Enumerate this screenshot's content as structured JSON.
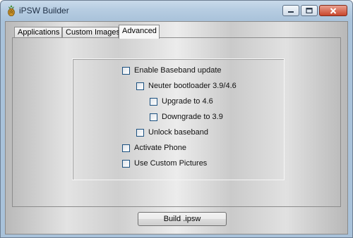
{
  "window": {
    "title": "iPSW Builder",
    "icon": "pineapple-icon",
    "controls": {
      "minimize_icon": "minimize-icon",
      "maximize_icon": "maximize-icon",
      "close_icon": "close-icon"
    }
  },
  "tabs": [
    {
      "label": "Applications",
      "active": false
    },
    {
      "label": "Custom Images",
      "active": false
    },
    {
      "label": "Advanced",
      "active": true
    }
  ],
  "advanced": {
    "options": [
      {
        "label": "Enable Baseband update",
        "checked": false
      },
      {
        "label": "Neuter bootloader 3.9/4.6",
        "checked": false
      },
      {
        "label": "Upgrade to 4.6",
        "checked": false
      },
      {
        "label": "Downgrade to 3.9",
        "checked": false
      },
      {
        "label": "Unlock baseband",
        "checked": false
      },
      {
        "label": "Activate Phone",
        "checked": false
      },
      {
        "label": "Use Custom Pictures",
        "checked": false
      }
    ]
  },
  "actions": {
    "build_label": "Build .ipsw"
  }
}
